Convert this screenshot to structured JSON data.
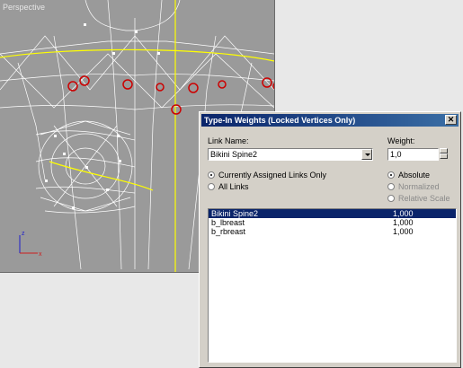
{
  "viewport": {
    "label": "Perspective",
    "axis_labels": {
      "z": "z",
      "x": "x"
    }
  },
  "dialog": {
    "title": "Type-In Weights (Locked Vertices Only)",
    "close_symbol": "✕",
    "link_name_label": "Link Name:",
    "link_name_value": "Bikini Spine2",
    "weight_label": "Weight:",
    "weight_value": "1,0",
    "radios_links": [
      {
        "label": "Currently Assigned Links Only",
        "selected": true
      },
      {
        "label": "All Links",
        "selected": false
      }
    ],
    "radios_mode": [
      {
        "label": "Absolute",
        "selected": true,
        "enabled": true
      },
      {
        "label": "Normalized",
        "selected": false,
        "enabled": false
      },
      {
        "label": "Relative Scale",
        "selected": false,
        "enabled": false
      }
    ],
    "links": [
      {
        "name": "Bikini Spine2",
        "weight": "1,000",
        "selected": true
      },
      {
        "name": "b_lbreast",
        "weight": "1,000",
        "selected": false
      },
      {
        "name": "b_rbreast",
        "weight": "1,000",
        "selected": false
      }
    ]
  },
  "colors": {
    "viewport_bg": "#9a9a9a",
    "wire": "#ffffff",
    "spline": "#ffff00",
    "selected_vertex": "#cc0000",
    "title_bar": "#0a246a",
    "dialog_bg": "#d4d0c8"
  }
}
